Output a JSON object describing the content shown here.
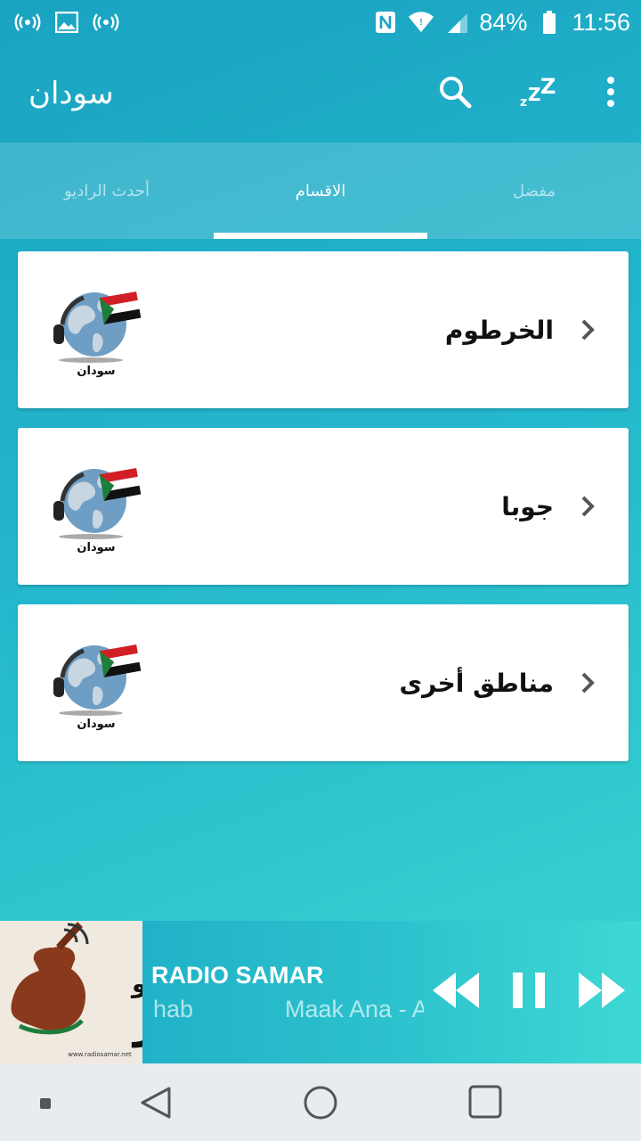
{
  "status_bar": {
    "battery": "84%",
    "time": "11:56",
    "icons": [
      "radio-signal-icon",
      "image-icon",
      "radio-signal-icon",
      "nfc-icon",
      "wifi-icon",
      "cell-signal-icon",
      "battery-icon"
    ]
  },
  "app_bar": {
    "title": "سودان",
    "actions": [
      "search-icon",
      "sleep-timer-icon",
      "more-options-icon"
    ]
  },
  "tabs": [
    {
      "label": "أحدث الراديو",
      "active": false
    },
    {
      "label": "الاقسام",
      "active": true
    },
    {
      "label": "مفضل",
      "active": false
    }
  ],
  "categories": [
    {
      "name": "الخرطوم",
      "logo_caption": "سودان"
    },
    {
      "name": "جوبا",
      "logo_caption": "سودان"
    },
    {
      "name": "مناطق أخرى",
      "logo_caption": "سودان"
    }
  ],
  "player": {
    "station": "RADIO SAMAR",
    "track_scroll_a": "hab",
    "track_scroll_b": "Maak Ana - A",
    "art_text": "راديو سمر",
    "art_url_text": "www.radiosamar.net",
    "controls": [
      "rewind-icon",
      "pause-icon",
      "fast-forward-icon"
    ]
  },
  "colors": {
    "gradient_start": "#1aa3c2",
    "gradient_end": "#3dd9d2",
    "card": "#ffffff",
    "nav_bar": "#e9ecef"
  }
}
